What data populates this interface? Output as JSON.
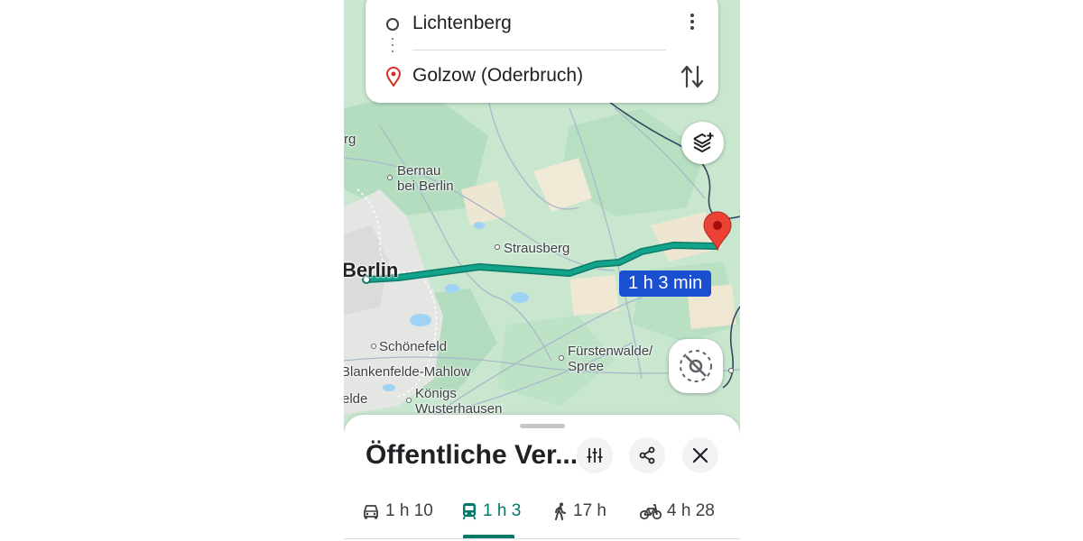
{
  "route": {
    "origin": "Lichtenberg",
    "destination": "Golzow (Oderbruch)"
  },
  "map": {
    "labels": {
      "edge_top": "rg",
      "bernau": "Bernau\nbei Berlin",
      "strausberg": "Strausberg",
      "berlin": "Berlin",
      "schoenefeld": "Schönefeld",
      "blankenfelde": "Blankenfelde-Mahlow",
      "edge_left": "elde",
      "koenigs": "Königs\nWusterhausen",
      "fuerstenwalde": "Fürstenwalde/\nSpree"
    },
    "duration_badge": "1 h 3 min",
    "route_color": "#0f9d85",
    "destination_pin_color": "#ea4335"
  },
  "sheet": {
    "title": "Öffentliche Ver...",
    "modes": [
      {
        "icon": "car-icon",
        "label": "1 h 10"
      },
      {
        "icon": "transit-icon",
        "label": "1 h 3",
        "selected": true
      },
      {
        "icon": "walk-icon",
        "label": "17 h"
      },
      {
        "icon": "bike-icon",
        "label": "4 h 28"
      }
    ],
    "accent": "#00796b"
  }
}
